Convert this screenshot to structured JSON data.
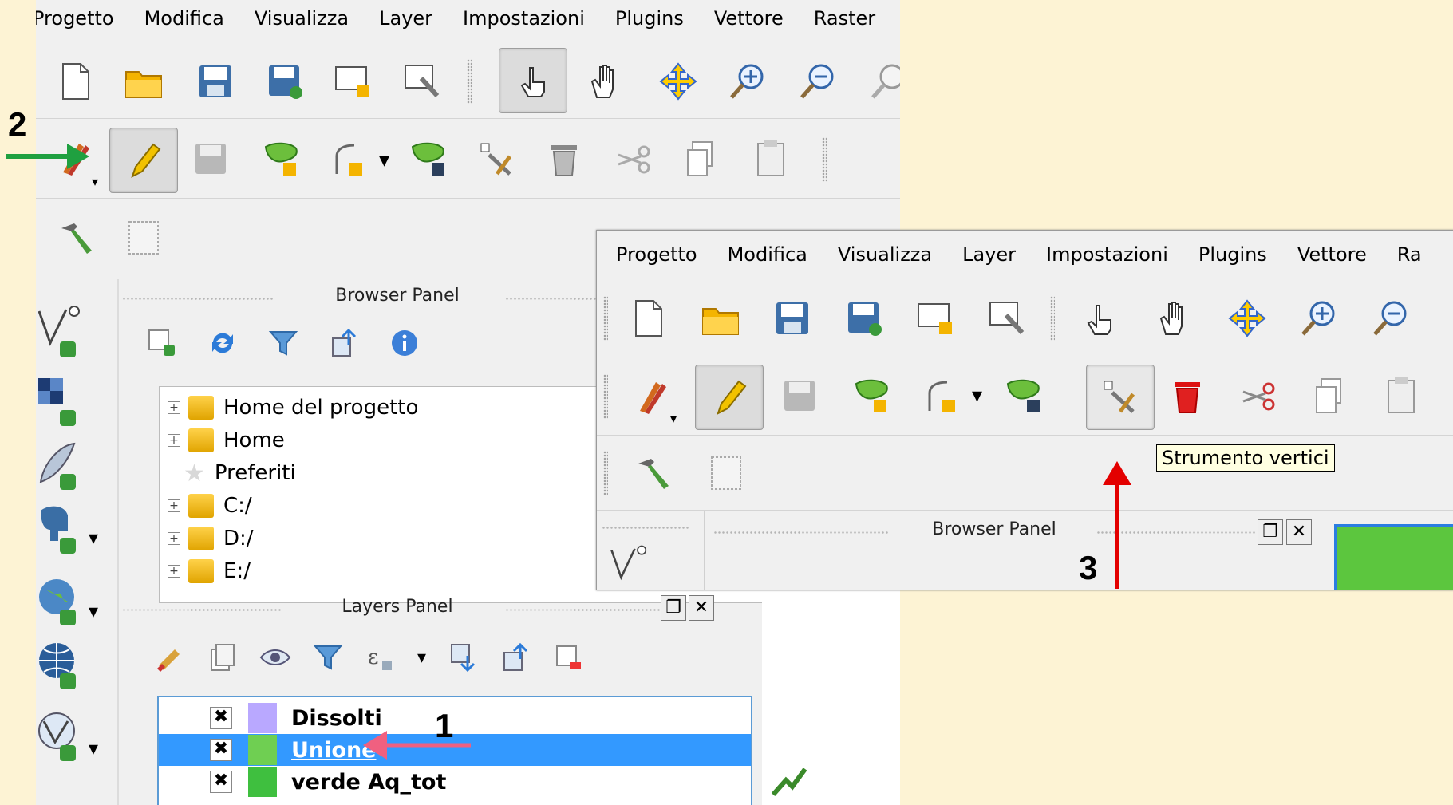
{
  "menu": {
    "items": [
      "Progetto",
      "Modifica",
      "Visualizza",
      "Layer",
      "Impostazioni",
      "Plugins",
      "Vettore",
      "Raster"
    ],
    "items_inset": [
      "Progetto",
      "Modifica",
      "Visualizza",
      "Layer",
      "Impostazioni",
      "Plugins",
      "Vettore",
      "Ra"
    ]
  },
  "browser_panel": {
    "title": "Browser Panel",
    "items": [
      "Home del progetto",
      "Home",
      "Preferiti",
      "C:/",
      "D:/",
      "E:/"
    ]
  },
  "layers_panel": {
    "title": "Layers Panel",
    "layers": [
      {
        "name": "Dissolti",
        "checked": "✖",
        "color": "#b9a8ff"
      },
      {
        "name": "Unione",
        "checked": "✖",
        "color": "#6fcf52",
        "selected": true
      },
      {
        "name": "verde Aq_tot",
        "checked": "✖",
        "color": "#3fbf3f"
      }
    ]
  },
  "tooltip": {
    "text": "Strumento vertici"
  },
  "annotations": {
    "a1": "1",
    "a2": "2",
    "a3": "3"
  },
  "colors": {
    "background": "#fdf3d4",
    "arrow1": "#f06080",
    "arrow2": "#1fa040",
    "arrow3": "#e30000",
    "selection": "#3399ff"
  }
}
